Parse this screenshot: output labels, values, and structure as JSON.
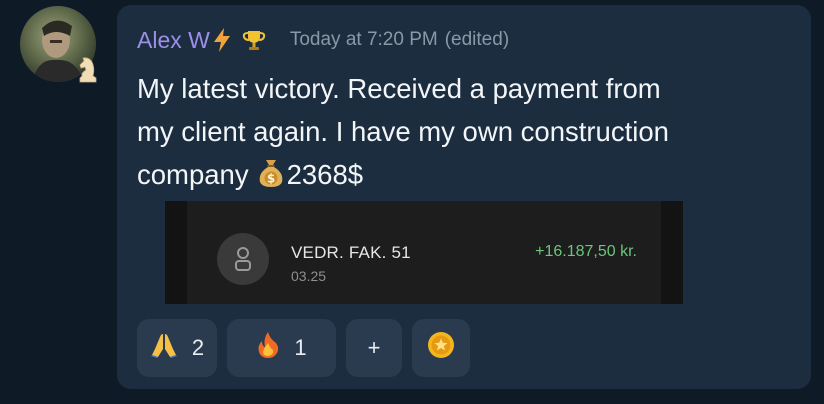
{
  "message": {
    "author": "Alex W",
    "author_badges": [
      "lightning-icon",
      "trophy-icon"
    ],
    "timestamp": "Today at 7:20 PM",
    "edited": "(edited)",
    "text_line1": "My latest victory. Received a payment from",
    "text_line2": "my client again. I have my own construction",
    "text_line3_before": "company",
    "text_line3_after": "2368$"
  },
  "attachment": {
    "transaction_title": "VEDR. FAK. 51",
    "transaction_date": "03.25",
    "transaction_amount": "+16.187,50 kr."
  },
  "reactions": [
    {
      "icon": "folded-hands-icon",
      "count": "2"
    },
    {
      "icon": "fire-icon",
      "count": "1"
    },
    {
      "icon": "plus-icon",
      "label": "+"
    },
    {
      "icon": "coin-icon"
    }
  ],
  "colors": {
    "background": "#0f1a27",
    "bubble": "#1d2d40",
    "author": "#9c8fe8",
    "meta": "#8a98a9",
    "reaction_bg": "#2a3b50",
    "amount_green": "#6cc57c"
  }
}
